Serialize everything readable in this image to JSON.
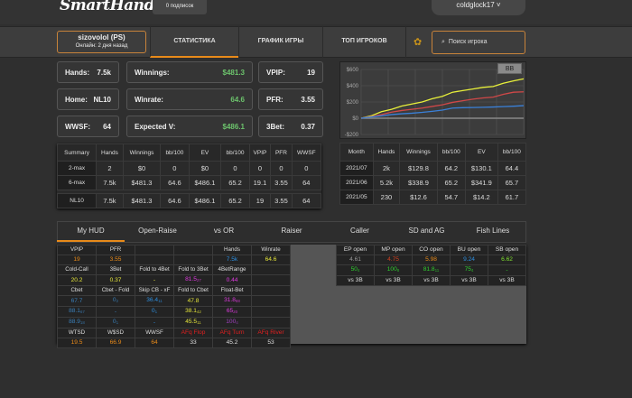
{
  "header": {
    "logo": "SmartHand",
    "subscriptions": "0 подписок",
    "user": "coldglock17 ˅"
  },
  "player": {
    "name": "sizovolol (PS)",
    "status": "Онлайн: 2 дня назад"
  },
  "nav": {
    "tabs": [
      "СТАТИСТИКА",
      "ГРАФИК ИГРЫ",
      "ТОП ИГРОКОВ"
    ],
    "active": 0,
    "search_placeholder": "Поиск игрока"
  },
  "cards": [
    {
      "label": "Hands:",
      "value": "7.5k"
    },
    {
      "label": "Winnings:",
      "value": "$481.3"
    },
    {
      "label": "VPIP:",
      "value": "19"
    },
    {
      "label": "Home:",
      "value": "NL10"
    },
    {
      "label": "Winrate:",
      "value": "64.6"
    },
    {
      "label": "PFR:",
      "value": "3.55"
    },
    {
      "label": "WWSF:",
      "value": "64"
    },
    {
      "label": "Expected V:",
      "value": "$486.1"
    },
    {
      "label": "3Bet:",
      "value": "0.37"
    }
  ],
  "summary": {
    "headers": [
      "Summary",
      "Hands",
      "Winnings",
      "bb/100",
      "EV",
      "bb/100",
      "VPIP",
      "PFR",
      "WWSF"
    ],
    "rows": [
      [
        "2-max",
        "2",
        "$0",
        "0",
        "$0",
        "0",
        "0",
        "0",
        "0"
      ],
      [
        "6-max",
        "7.5k",
        "$481.3",
        "64.6",
        "$486.1",
        "65.2",
        "19.1",
        "3.55",
        "64"
      ]
    ],
    "total": [
      "NL10",
      "7.5k",
      "$481.3",
      "64.6",
      "$486.1",
      "65.2",
      "19",
      "3.55",
      "64"
    ]
  },
  "chart_data": {
    "type": "line",
    "button": "BB",
    "yticks": [
      "$600",
      "$400",
      "$200",
      "$0",
      "-$200"
    ],
    "ylim": [
      -200,
      600
    ],
    "x": [
      0,
      1,
      2,
      3,
      4,
      5,
      6,
      7,
      8,
      9,
      10,
      11,
      12,
      13,
      14,
      15,
      16
    ],
    "series": [
      {
        "name": "winnings-ev",
        "color": "#e8f03a",
        "values": [
          0,
          30,
          80,
          110,
          150,
          175,
          200,
          240,
          270,
          320,
          340,
          360,
          380,
          390,
          430,
          460,
          485
        ]
      },
      {
        "name": "winnings",
        "color": "#d04848",
        "values": [
          0,
          20,
          45,
          75,
          95,
          110,
          125,
          145,
          165,
          195,
          215,
          235,
          250,
          260,
          295,
          320,
          325
        ]
      },
      {
        "name": "showdown",
        "color": "#3a80d8",
        "values": [
          0,
          15,
          30,
          45,
          55,
          62,
          72,
          85,
          100,
          125,
          130,
          132,
          135,
          138,
          143,
          148,
          155
        ]
      }
    ]
  },
  "months": {
    "headers": [
      "Month",
      "Hands",
      "Winnings",
      "bb/100",
      "EV",
      "bb/100"
    ],
    "rows": [
      [
        "2021/07",
        "2k",
        "$129.8",
        "64.2",
        "$130.1",
        "64.4"
      ],
      [
        "2021/06",
        "5.2k",
        "$338.9",
        "65.2",
        "$341.9",
        "65.7"
      ],
      [
        "2021/05",
        "230",
        "$12.6",
        "54.7",
        "$14.2",
        "61.7"
      ]
    ]
  },
  "hud_tabs": [
    "My HUD",
    "Open-Raise",
    "vs OR",
    "Raiser",
    "Caller",
    "SD and AG",
    "Fish Lines"
  ],
  "hud": {
    "r0": [
      "VPIP",
      "PFR",
      "",
      "",
      "Hands",
      "Winrate"
    ],
    "r1": [
      "19",
      "3.55",
      "",
      "",
      "7.5k",
      "64.6"
    ],
    "r2": [
      "Cold-Call",
      "3Bet",
      "Fold to 4Bet",
      "Fold to 3Bet",
      "4BetRange",
      ""
    ],
    "r3": [
      "20.2",
      "0.37",
      "-",
      "81.5",
      "0.44",
      ""
    ],
    "r3s": [
      "",
      "",
      "",
      "27",
      "",
      ""
    ],
    "r4": [
      "Cbet",
      "Cbet - Fold",
      "Skip CB - xF",
      "Fold to Cbet",
      "Float-Bet",
      ""
    ],
    "r5": [
      "67.7",
      "0",
      "36.4",
      "47.8",
      "31.8",
      ""
    ],
    "r5s": [
      "",
      "2",
      "11",
      "",
      "88",
      ""
    ],
    "r6": [
      "88.1",
      "-",
      "0",
      "38.1",
      "65",
      ""
    ],
    "r6s": [
      "67",
      "",
      "1",
      "42",
      "20",
      ""
    ],
    "r7": [
      "88.9",
      "0",
      "-",
      "45.5",
      "100",
      ""
    ],
    "r7s": [
      "18",
      "1",
      "",
      "11",
      "4",
      ""
    ],
    "r8": [
      "WTSD",
      "W$SD",
      "WWSF",
      "AFq Flop",
      "AFq Turn",
      "AFq River"
    ],
    "r9": [
      "19.5",
      "66.9",
      "64",
      "33",
      "45.2",
      "53"
    ]
  },
  "positions": {
    "headers": [
      "EP open",
      "MP open",
      "CO open",
      "BU open",
      "SB open"
    ],
    "open": [
      "4.61",
      "4.75",
      "5.98",
      "9.24",
      "6.62"
    ],
    "vs3b": [
      "50",
      "100",
      "81.8",
      "75",
      "-"
    ],
    "vs3b_s": [
      "4",
      "8",
      "11",
      "4",
      ""
    ],
    "label": "vs 3B"
  }
}
